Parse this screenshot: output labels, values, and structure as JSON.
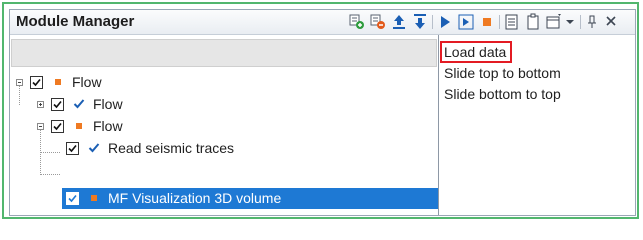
{
  "panel": {
    "title": "Module Manager"
  },
  "toolbar": {
    "icons": [
      "add-module-icon",
      "remove-module-icon",
      "move-up-icon",
      "move-down-icon",
      "run-icon",
      "run-step-icon",
      "stop-icon",
      "module-list-icon",
      "clipboard-icon",
      "dropdown-menu-icon",
      "chevron-down-icon",
      "pin-icon",
      "close-icon"
    ],
    "stop_color": "#ef7a22",
    "run_color": "#1b5fb4"
  },
  "tree": {
    "items": [
      {
        "label": "Flow",
        "level": 0,
        "expander": "minus",
        "checked": true,
        "marker": "square"
      },
      {
        "label": "Flow",
        "level": 1,
        "expander": "plus",
        "checked": true,
        "marker": "tick"
      },
      {
        "label": "Flow",
        "level": 1,
        "expander": "minus",
        "checked": true,
        "marker": "square"
      },
      {
        "label": "Read seismic traces",
        "level": 2,
        "expander": "none",
        "checked": true,
        "marker": "tick"
      },
      {
        "label": "MF Visualization 3D volume",
        "level": 2,
        "expander": "none",
        "checked": true,
        "marker": "square",
        "selected": true
      }
    ],
    "marker_colors": {
      "square": "#ef7a22",
      "tick": "#1b5fb4"
    },
    "selection_color": "#1e79d4"
  },
  "actions": {
    "items": [
      {
        "label": "Load data",
        "highlighted": true
      },
      {
        "label": "Slide top to bottom",
        "highlighted": false
      },
      {
        "label": "Slide bottom to top",
        "highlighted": false
      }
    ],
    "highlight_color": "#e31b23"
  }
}
